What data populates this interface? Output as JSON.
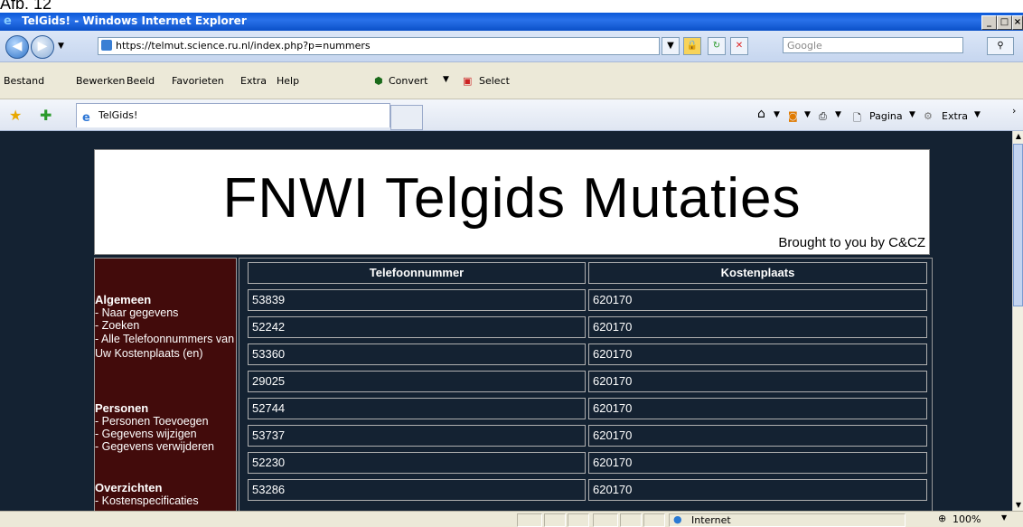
{
  "caption": "Afb. 12",
  "window": {
    "title": "TelGids! - Windows Internet Explorer",
    "controls": [
      "_",
      "□",
      "×"
    ]
  },
  "address_bar": {
    "url": "https://telmut.science.ru.nl/index.php?p=nummers",
    "search_placeholder": "Google"
  },
  "menu": {
    "items": [
      "Bestand",
      "Bewerken",
      "Beeld",
      "Favorieten",
      "Extra",
      "Help"
    ],
    "convert_label": "Convert",
    "select_label": "Select"
  },
  "favorites": {
    "tab_title": "TelGids!",
    "commands": {
      "page": "Pagina",
      "extra": "Extra"
    }
  },
  "page": {
    "banner_title": "FNWI Telgids Mutaties",
    "banner_subtitle": "Brought to you by C&CZ",
    "sidebar": {
      "sections": [
        {
          "heading": "Algemeen",
          "links": [
            "- Naar gegevens",
            "- Zoeken",
            "- Alle Telefoonnummers van Uw Kostenplaats (en)"
          ]
        },
        {
          "heading": "Personen",
          "links": [
            "- Personen Toevoegen",
            "- Gegevens wijzigen",
            "- Gegevens verwijderen"
          ]
        },
        {
          "heading": "Overzichten",
          "links": [
            "- Kostenspecificaties"
          ]
        }
      ]
    },
    "table": {
      "headers": [
        "Telefoonnummer",
        "Kostenplaats"
      ],
      "rows": [
        [
          "53839",
          "620170"
        ],
        [
          "52242",
          "620170"
        ],
        [
          "53360",
          "620170"
        ],
        [
          "29025",
          "620170"
        ],
        [
          "52744",
          "620170"
        ],
        [
          "53737",
          "620170"
        ],
        [
          "52230",
          "620170"
        ],
        [
          "53286",
          "620170"
        ]
      ]
    }
  },
  "status_bar": {
    "zone": "Internet",
    "zoom": "100%"
  }
}
